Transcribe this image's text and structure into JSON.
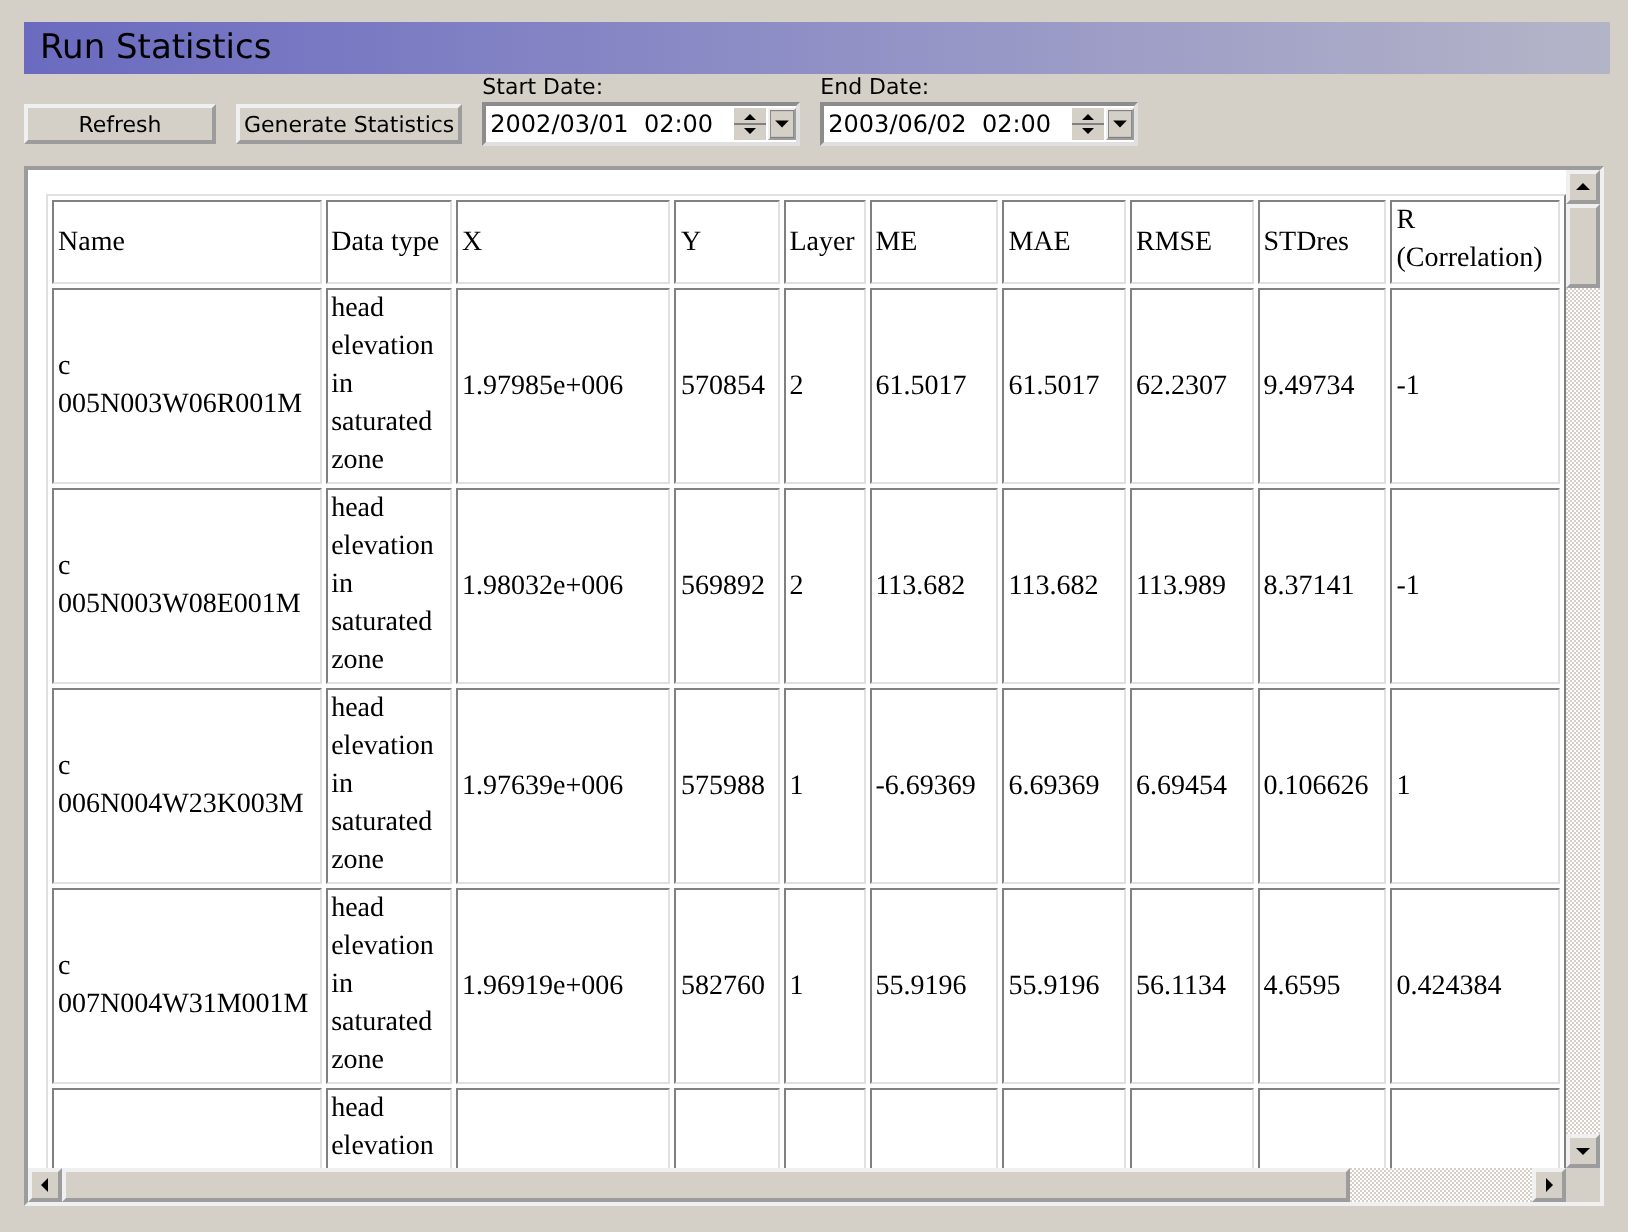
{
  "title": "Run Statistics",
  "toolbar": {
    "buttons": [
      "Refresh",
      "Generate Statistics"
    ],
    "date_fields": [
      {
        "label": "Start Date:",
        "value": "2002/03/01  02:00"
      },
      {
        "label": "End Date:",
        "value": "2003/06/02  02:00"
      }
    ]
  },
  "table": {
    "columns": [
      "Name",
      "Data type",
      "X",
      "Y",
      "Layer",
      "ME",
      "MAE",
      "RMSE",
      "STDres",
      "R (Correlation)"
    ],
    "rows": [
      [
        "c 005N003W06R001M",
        "head elevation in saturated zone",
        "1.97985e+006",
        "570854",
        "2",
        "61.5017",
        "61.5017",
        "62.2307",
        "9.49734",
        "-1"
      ],
      [
        "c 005N003W08E001M",
        "head elevation in saturated zone",
        "1.98032e+006",
        "569892",
        "2",
        "113.682",
        "113.682",
        "113.989",
        "8.37141",
        "-1"
      ],
      [
        "c 006N004W23K003M",
        "head elevation in saturated zone",
        "1.97639e+006",
        "575988",
        "1",
        "-6.69369",
        "6.69369",
        "6.69454",
        "0.106626",
        "1"
      ],
      [
        "c 007N004W31M001M",
        "head elevation in saturated zone",
        "1.96919e+006",
        "582760",
        "1",
        "55.9196",
        "55.9196",
        "56.1134",
        "4.6595",
        "0.424384"
      ],
      [
        "",
        "head elevation",
        "",
        "",
        "",
        "",
        "",
        "",
        "",
        ""
      ]
    ]
  }
}
